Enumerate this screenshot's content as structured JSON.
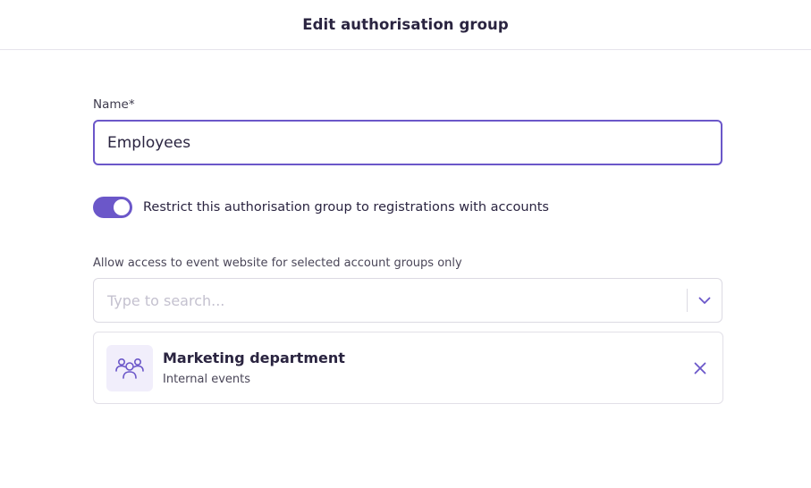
{
  "header": {
    "title": "Edit authorisation group"
  },
  "form": {
    "name_label": "Name*",
    "name_value": "Employees",
    "restrict_toggle": {
      "label": "Restrict this authorisation group to registrations with accounts",
      "checked": true
    },
    "account_groups": {
      "label": "Allow access to event website for selected account groups only",
      "search_placeholder": "Type to search...",
      "search_value": "",
      "selected": [
        {
          "name": "Marketing department",
          "subtitle": "Internal events",
          "icon": "users-group-icon"
        }
      ]
    }
  },
  "colors": {
    "accent": "#6b57c9",
    "text_primary": "#2a2440",
    "border": "#dcdae3",
    "icon_bg": "#f1eefb"
  },
  "icons": {
    "dropdown": "chevron-down-icon",
    "remove": "close-icon"
  }
}
